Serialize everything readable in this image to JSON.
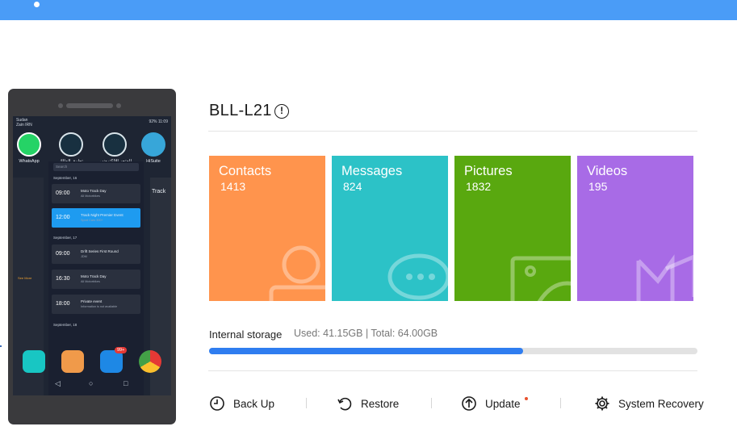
{
  "device": {
    "model": "BLL-L21",
    "phone_screen": {
      "carrier": "Zain IRN",
      "carrier_line1": "Sudan",
      "battery": "92%",
      "clock": "11:09",
      "apps": [
        {
          "label": "WhatsApp",
          "icon": "whatsapp-icon"
        },
        {
          "label": "تطبيق المالك",
          "icon": "app-icon"
        },
        {
          "label": "المتجر الالكتروني",
          "icon": "app-icon"
        },
        {
          "label": "HiSuite",
          "icon": "hisuite-icon"
        }
      ],
      "search_placeholder": "Search",
      "days": [
        "September, 16",
        "September, 17",
        "September, 18"
      ],
      "events": [
        {
          "time": "09:00",
          "name": "Moto Track Day",
          "sub": "All Motorbikes",
          "selected": false
        },
        {
          "time": "12:00",
          "name": "Track Night Premier Event",
          "sub": "Sport Cars 300+",
          "selected": true
        },
        {
          "time": "09:00",
          "name": "Drift Series First Round",
          "sub": "JDM",
          "selected": false
        },
        {
          "time": "16:30",
          "name": "Moto Track Day",
          "sub": "All Motorbikes",
          "selected": false
        },
        {
          "time": "18:00",
          "name": "Private event",
          "sub": "Information is not available",
          "selected": false
        }
      ],
      "right_card_title": "Track",
      "left_card_see_more": "See More",
      "msg_badge": "99+"
    }
  },
  "stats": {
    "contacts": {
      "label": "Contacts",
      "count": "1413",
      "color": "#ff944d"
    },
    "messages": {
      "label": "Messages",
      "count": "824",
      "color": "#2cc2c7"
    },
    "pictures": {
      "label": "Pictures",
      "count": "1832",
      "color": "#59a80f"
    },
    "videos": {
      "label": "Videos",
      "count": "195",
      "color": "#a86be6"
    }
  },
  "storage": {
    "label": "Internal storage",
    "usage": "Used: 41.15GB | Total: 64.00GB",
    "fraction_used": 0.643
  },
  "actions": {
    "backup": "Back Up",
    "restore": "Restore",
    "update": "Update",
    "recovery": "System Recovery"
  },
  "colors": {
    "topbar": "#4a9cf7",
    "progress": "#2f7df0",
    "update_dot": "#e8522f"
  }
}
